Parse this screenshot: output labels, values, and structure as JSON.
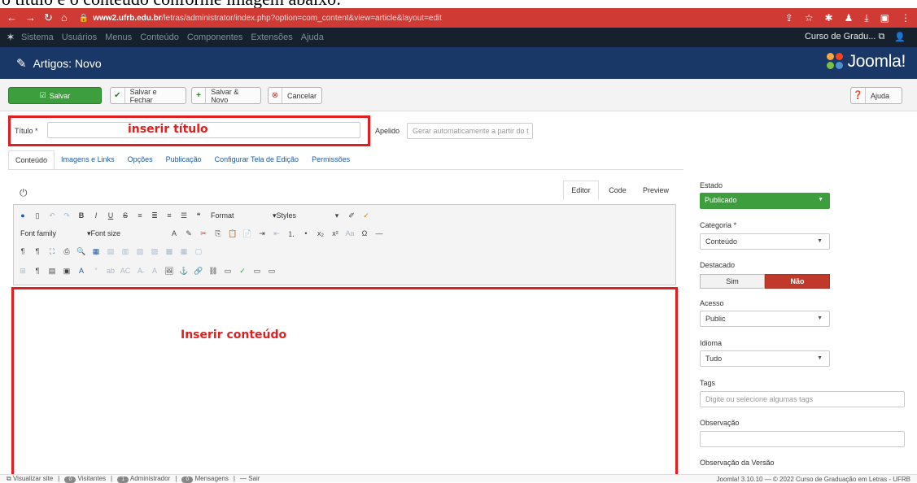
{
  "caption": "o título e o conteúdo conforme imagem abaixo:",
  "browser": {
    "url_host": "www2.ufrb.edu.br",
    "url_path": "/letras/administrator/index.php?option=com_content&view=article&layout=edit"
  },
  "adminbar": {
    "menu": [
      "Sistema",
      "Usuários",
      "Menus",
      "Conteúdo",
      "Componentes",
      "Extensões",
      "Ajuda"
    ],
    "site_label": "Curso de Gradu..."
  },
  "header": {
    "title": "Artigos: Novo",
    "brand": "Joomla!"
  },
  "toolbar": {
    "save": "Salvar",
    "save_close": "Salvar e Fechar",
    "save_new": "Salvar & Novo",
    "cancel": "Cancelar",
    "help": "Ajuda"
  },
  "form": {
    "title_label": "Título *",
    "title_annotation": "inserir título",
    "alias_label": "Apelido",
    "alias_placeholder": "Gerar automaticamente a partir do t"
  },
  "tabs": [
    "Conteúdo",
    "Imagens e Links",
    "Opções",
    "Publicação",
    "Configurar Tela de Edição",
    "Permissões"
  ],
  "editor_modes": [
    "Editor",
    "Code",
    "Preview"
  ],
  "editor": {
    "format": "Format",
    "styles": "Styles",
    "font_family": "Font family",
    "font_size": "Font size",
    "content_annotation": "Inserir conteúdo"
  },
  "sidebar": {
    "estado_label": "Estado",
    "estado_value": "Publicado",
    "categoria_label": "Categoria *",
    "categoria_value": "Conteúdo",
    "destacado_label": "Destacado",
    "destacado_yes": "Sim",
    "destacado_no": "Não",
    "acesso_label": "Acesso",
    "acesso_value": "Public",
    "idioma_label": "Idioma",
    "idioma_value": "Tudo",
    "tags_label": "Tags",
    "tags_placeholder": "Digite ou selecione algumas tags",
    "observacao_label": "Observação",
    "versao_label": "Observação da Versão"
  },
  "statusbar": {
    "view_site": "Visualizar site",
    "visitors_count": "0",
    "visitors": "Visitantes",
    "admin_count": "1",
    "admin": "Administrador",
    "messages_count": "0",
    "messages": "Mensagens",
    "logout": "Sair",
    "footer": "Joomla! 3.10.10 — © 2022 Curso de Graduação em Letras - UFRB"
  }
}
